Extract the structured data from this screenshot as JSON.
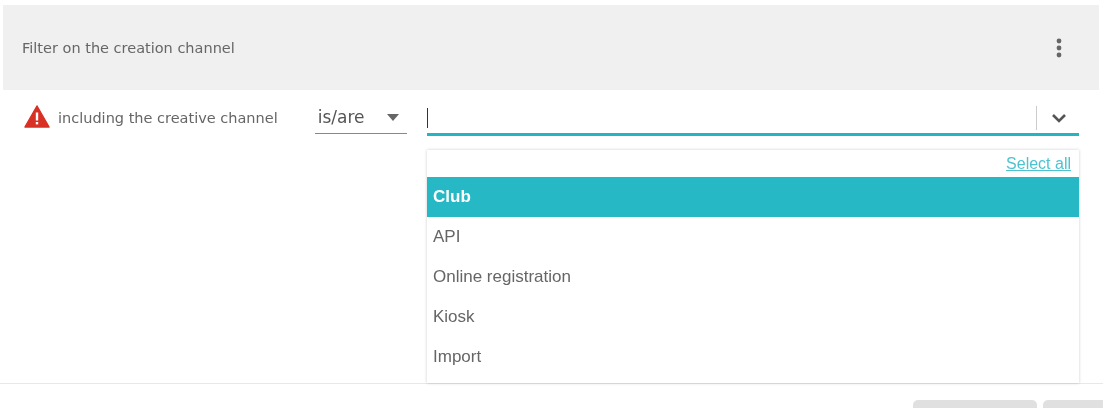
{
  "header": {
    "title": "Filter on the creation channel"
  },
  "condition": {
    "label": "including the creative channel",
    "operator": "is/are"
  },
  "dropdown": {
    "select_all": "Select all",
    "items": [
      {
        "label": "Club",
        "selected": true
      },
      {
        "label": "API",
        "selected": false
      },
      {
        "label": "Online registration",
        "selected": false
      },
      {
        "label": "Kiosk",
        "selected": false
      },
      {
        "label": "Import",
        "selected": false
      }
    ]
  }
}
